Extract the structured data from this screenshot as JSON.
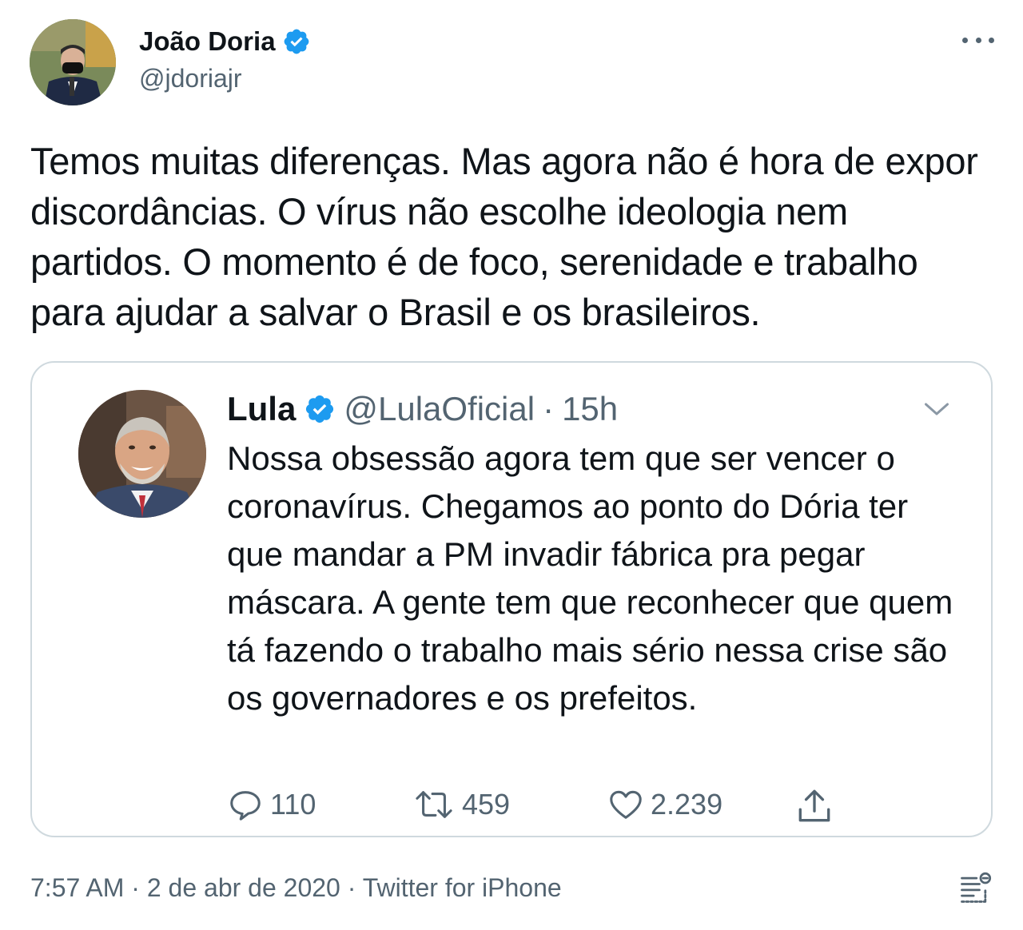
{
  "author": {
    "name": "João Doria",
    "handle": "@jdoriajr",
    "verified": true
  },
  "tweet": {
    "text": "Temos muitas diferenças. Mas agora não é hora de expor discordâncias. O vírus não escolhe ideologia nem partidos. O momento é de foco, serenidade e trabalho para ajudar a salvar o Brasil e os brasileiros."
  },
  "quoted": {
    "name": "Lula",
    "handle": "@LulaOficial",
    "separator": "·",
    "time": "15h",
    "verified": true,
    "text": "Nossa obsessão agora tem que ser vencer o coronavírus. Chegamos ao ponto do Dória ter que mandar a PM invadir fábrica pra pegar máscara. A gente tem que reconhecer que quem tá fazendo o trabalho mais sério nessa crise são os governadores e os prefeitos.",
    "actions": {
      "replies": "110",
      "retweets": "459",
      "likes": "2.239"
    }
  },
  "footer": {
    "time": "7:57 AM",
    "sep1": "·",
    "date": "2 de abr de 2020",
    "sep2": "·",
    "source": "Twitter for iPhone"
  },
  "icons": {
    "verified": "verified-badge-icon",
    "more": "more-dots-icon",
    "chevron": "chevron-down-icon",
    "reply": "reply-icon",
    "retweet": "retweet-icon",
    "like": "heart-icon",
    "share": "share-icon",
    "analytics": "analytics-icon"
  },
  "colors": {
    "verified": "#1d9bf0",
    "secondary_text": "#536471",
    "primary_text": "#0f1419",
    "border": "#cfd9de"
  }
}
